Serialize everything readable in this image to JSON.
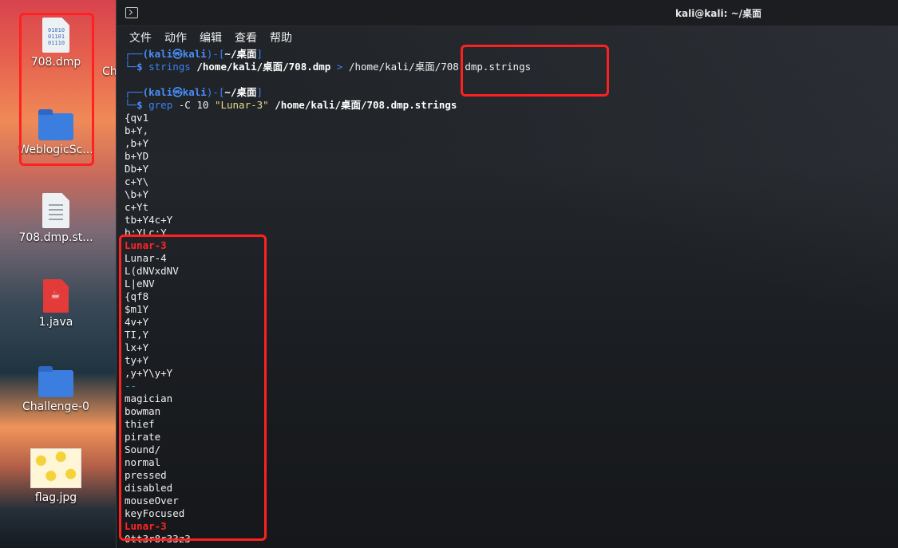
{
  "desktop": {
    "icons": [
      {
        "label": "708.dmp",
        "icon": "binary-file-icon"
      },
      {
        "label": "WeblogicSc...",
        "icon": "folder-icon"
      },
      {
        "label": "708.dmp.st...",
        "icon": "text-file-icon"
      },
      {
        "label": "1.java",
        "icon": "java-file-icon"
      },
      {
        "label": "Challenge-0",
        "icon": "folder-icon"
      },
      {
        "label": "flag.jpg",
        "icon": "image-file-icon"
      }
    ],
    "partial_label": "Ch"
  },
  "terminal": {
    "title": "kali@kali: ~/桌面",
    "menu": [
      "文件",
      "动作",
      "编辑",
      "查看",
      "帮助"
    ],
    "prompt": {
      "corner_top": "┌──",
      "corner_bottom": "└─",
      "open": "(",
      "user": "kali",
      "at": "㉿",
      "host": "kali",
      "close": ")-[",
      "dir": "~/桌面",
      "end": "]",
      "dollar": "$"
    },
    "cmd1": {
      "name": "strings",
      "arg": "/home/kali/桌面/708.dmp",
      "redirect": ">",
      "out": "/home/kali/桌面/708.dmp.strings"
    },
    "cmd2": {
      "name": "grep",
      "flags": "-C 10",
      "pattern": "\"Lunar-3\"",
      "file": "/home/kali/桌面/708.dmp.strings"
    },
    "output": [
      {
        "text": "{qv1"
      },
      {
        "text": "b+Y,"
      },
      {
        "text": ",b+Y"
      },
      {
        "text": "b+YD"
      },
      {
        "text": "Db+Y"
      },
      {
        "text": "c+Y\\"
      },
      {
        "text": "\\b+Y"
      },
      {
        "text": "c+Yt"
      },
      {
        "text": "tb+Y4c+Y"
      },
      {
        "text": "b:YLc:Y"
      },
      {
        "text": "Lunar-3",
        "match": true
      },
      {
        "text": "Lunar-4"
      },
      {
        "text": "L(dNVxdNV"
      },
      {
        "text": "L|eNV"
      },
      {
        "text": "{qf8"
      },
      {
        "text": "$m1Y"
      },
      {
        "text": "4v+Y"
      },
      {
        "text": "TI,Y"
      },
      {
        "text": "lx+Y"
      },
      {
        "text": "ty+Y"
      },
      {
        "text": ",y+Y\\y+Y"
      },
      {
        "text": "--",
        "separator": true
      },
      {
        "text": "magician"
      },
      {
        "text": "bowman"
      },
      {
        "text": "thief"
      },
      {
        "text": "pirate"
      },
      {
        "text": "Sound/"
      },
      {
        "text": "normal"
      },
      {
        "text": "pressed"
      },
      {
        "text": "disabled"
      },
      {
        "text": "mouseOver"
      },
      {
        "text": "keyFocused"
      },
      {
        "text": "Lunar-3",
        "match": true
      },
      {
        "text": "0tt3r8r33z3"
      }
    ]
  },
  "colors": {
    "annotation": "#ff2020",
    "match": "#ff2525",
    "prompt_blue": "#3b82f6"
  }
}
